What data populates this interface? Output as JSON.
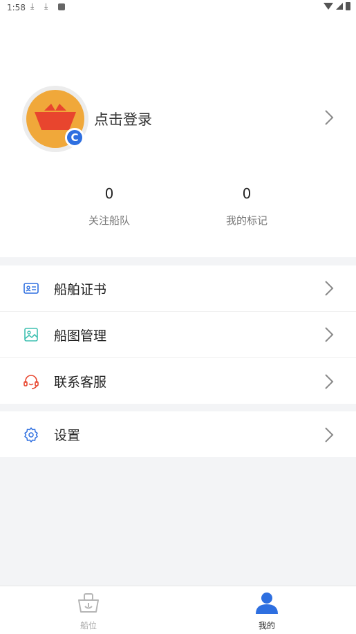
{
  "status_bar": {
    "time": "1:58"
  },
  "profile": {
    "login_text": "点击登录",
    "badge_letter": "C",
    "stats": [
      {
        "value": "0",
        "label": "关注船队"
      },
      {
        "value": "0",
        "label": "我的标记"
      }
    ]
  },
  "menu": {
    "items": [
      {
        "label": "船舶证书",
        "icon": "id-card-icon"
      },
      {
        "label": "船图管理",
        "icon": "image-icon"
      },
      {
        "label": "联系客服",
        "icon": "headset-icon"
      },
      {
        "label": "设置",
        "icon": "gear-icon"
      }
    ]
  },
  "tabbar": {
    "tabs": [
      {
        "label": "船位"
      },
      {
        "label": "我的"
      }
    ]
  },
  "colors": {
    "accent": "#2e6fe0",
    "avatar_bg": "#f0a83a",
    "boat_red": "#e8452e"
  }
}
